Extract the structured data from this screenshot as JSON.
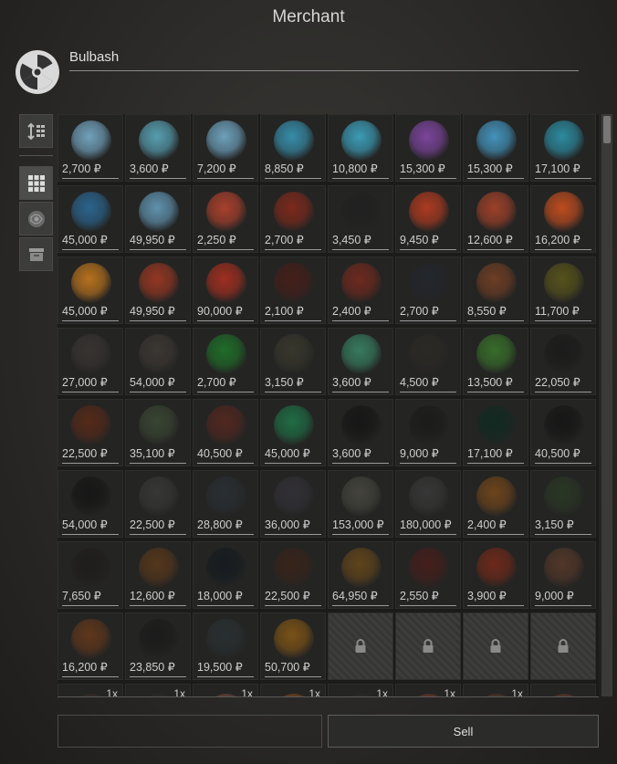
{
  "window": {
    "title": "Merchant"
  },
  "trader": {
    "name": "Bulbash",
    "icon": "radiation-icon"
  },
  "sidebar": {
    "buttons": [
      {
        "icon": "sort-icon"
      },
      {
        "icon": "grid-icon",
        "active": true
      },
      {
        "icon": "artifact-filter-icon"
      },
      {
        "icon": "container-icon"
      }
    ]
  },
  "currency": "₽",
  "items": [
    {
      "price": "2,700 ₽",
      "color": "#7fb7d6"
    },
    {
      "price": "3,600 ₽",
      "color": "#5fb3c9"
    },
    {
      "price": "7,200 ₽",
      "color": "#7ab6d6"
    },
    {
      "price": "8,850 ₽",
      "color": "#3a9fc0"
    },
    {
      "price": "10,800 ₽",
      "color": "#3fb0d0"
    },
    {
      "price": "15,300 ₽",
      "color": "#8a4ab0"
    },
    {
      "price": "15,300 ₽",
      "color": "#48a6d6"
    },
    {
      "price": "17,100 ₽",
      "color": "#2d9cb5"
    },
    {
      "price": "45,000 ₽",
      "color": "#2c6fa0"
    },
    {
      "price": "49,950 ₽",
      "color": "#6aa5c6"
    },
    {
      "price": "2,250 ₽",
      "color": "#c0452e"
    },
    {
      "price": "2,700 ₽",
      "color": "#8c2a1a"
    },
    {
      "price": "3,450 ₽",
      "color": "#202020"
    },
    {
      "price": "9,450 ₽",
      "color": "#c43e20"
    },
    {
      "price": "12,600 ₽",
      "color": "#b2452a"
    },
    {
      "price": "16,200 ₽",
      "color": "#d8531e"
    },
    {
      "price": "45,000 ₽",
      "color": "#d07f1c"
    },
    {
      "price": "49,950 ₽",
      "color": "#a83a22"
    },
    {
      "price": "90,000 ₽",
      "color": "#b5301f"
    },
    {
      "price": "2,100 ₽",
      "color": "#4a1e18"
    },
    {
      "price": "2,400 ₽",
      "color": "#7b2a1e"
    },
    {
      "price": "2,700 ₽",
      "color": "#23262e"
    },
    {
      "price": "8,550 ₽",
      "color": "#7a4224"
    },
    {
      "price": "11,700 ₽",
      "color": "#5f5a1a"
    },
    {
      "price": "27,000 ₽",
      "color": "#3b3634"
    },
    {
      "price": "54,000 ₽",
      "color": "#3f3a35"
    },
    {
      "price": "2,700 ₽",
      "color": "#1e7a2a"
    },
    {
      "price": "3,150 ₽",
      "color": "#3a3a2e"
    },
    {
      "price": "3,600 ₽",
      "color": "#3a8a6a"
    },
    {
      "price": "4,500 ₽",
      "color": "#2d2a26"
    },
    {
      "price": "13,500 ₽",
      "color": "#3b7a2c"
    },
    {
      "price": "22,050 ₽",
      "color": "#1a1a1a"
    },
    {
      "price": "22,500 ₽",
      "color": "#5e2a18"
    },
    {
      "price": "35,100 ₽",
      "color": "#3c4a34"
    },
    {
      "price": "40,500 ₽",
      "color": "#5a2820"
    },
    {
      "price": "45,000 ₽",
      "color": "#1e7a4a"
    },
    {
      "price": "3,600 ₽",
      "color": "#141414"
    },
    {
      "price": "9,000 ₽",
      "color": "#1a1a18"
    },
    {
      "price": "17,100 ₽",
      "color": "#0f2a22"
    },
    {
      "price": "40,500 ₽",
      "color": "#141414"
    },
    {
      "price": "54,000 ₽",
      "color": "#141414"
    },
    {
      "price": "22,500 ₽",
      "color": "#3a3a3a"
    },
    {
      "price": "28,800 ₽",
      "color": "#2a3036"
    },
    {
      "price": "36,000 ₽",
      "color": "#34323a"
    },
    {
      "price": "153,000 ₽",
      "color": "#4a4a42"
    },
    {
      "price": "180,000 ₽",
      "color": "#3a3a3a"
    },
    {
      "price": "2,400 ₽",
      "color": "#7a4a1a"
    },
    {
      "price": "3,150 ₽",
      "color": "#2a3a24"
    },
    {
      "price": "7,650 ₽",
      "color": "#1e1c1a"
    },
    {
      "price": "12,600 ₽",
      "color": "#5e3a1a"
    },
    {
      "price": "18,000 ₽",
      "color": "#141a20"
    },
    {
      "price": "22,500 ₽",
      "color": "#3a2418"
    },
    {
      "price": "64,950 ₽",
      "color": "#6a4a1a"
    },
    {
      "price": "2,550 ₽",
      "color": "#4a1e1a"
    },
    {
      "price": "3,900 ₽",
      "color": "#7a2a18"
    },
    {
      "price": "9,000 ₽",
      "color": "#5a3a2a"
    },
    {
      "price": "16,200 ₽",
      "color": "#6a3a1a"
    },
    {
      "price": "23,850 ₽",
      "color": "#1a1a1a"
    },
    {
      "price": "19,500 ₽",
      "color": "#2a3234"
    },
    {
      "price": "50,700 ₽",
      "color": "#8a5a14"
    }
  ],
  "locked_slots": 4,
  "partial_row": [
    {
      "qty": "1x",
      "color": "#3a2e28"
    },
    {
      "qty": "1x",
      "color": "#2e2c2a"
    },
    {
      "qty": "1x",
      "color": "#7a4a3a"
    },
    {
      "qty": "1x",
      "color": "#8a4a1a"
    },
    {
      "qty": "1x",
      "color": "#2e2c2a"
    },
    {
      "qty": "1x",
      "color": "#7a3a2a"
    },
    {
      "qty": "1x",
      "color": "#5a3a2a"
    },
    {
      "qty": "",
      "color": "#6a3a2a"
    }
  ],
  "actions": {
    "sell_label": "Sell"
  }
}
